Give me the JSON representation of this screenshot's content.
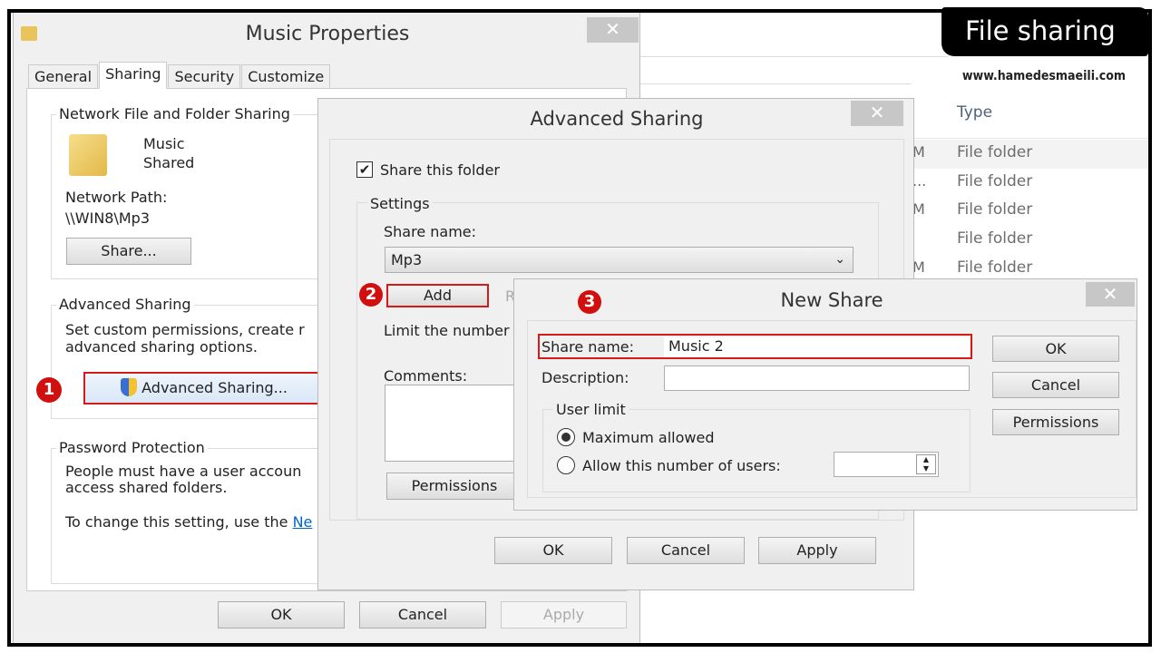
{
  "badge": {
    "title": "File sharing",
    "url": "www.hamedesmaeili.com"
  },
  "explorer": {
    "column_type": "Type",
    "rows": [
      {
        "frag": "M",
        "type": "File folder"
      },
      {
        "frag": "...",
        "type": "File folder"
      },
      {
        "frag": "M",
        "type": "File folder"
      },
      {
        "frag": "",
        "type": "File folder"
      },
      {
        "frag": "M",
        "type": "File folder"
      }
    ]
  },
  "props": {
    "title": "Music Properties",
    "close": "✕",
    "tabs": [
      "General",
      "Sharing",
      "Security",
      "Customize"
    ],
    "active_tab": "Sharing",
    "nffs": {
      "title": "Network File and Folder Sharing",
      "name": "Music",
      "status": "Shared",
      "path_label": "Network Path:",
      "path": "\\\\WIN8\\Mp3",
      "share_btn": "Share..."
    },
    "adv": {
      "title": "Advanced Sharing",
      "text1": "Set custom permissions, create r",
      "text2": "advanced sharing options.",
      "btn": "Advanced Sharing..."
    },
    "pwd": {
      "title": "Password Protection",
      "text1": "People must have a user accoun",
      "text2": "access shared folders.",
      "text3": "To change this setting, use the ",
      "link": "Ne"
    },
    "ok": "OK",
    "cancel": "Cancel",
    "apply": "Apply"
  },
  "adv": {
    "title": "Advanced Sharing",
    "close": "✕",
    "share_folder": "Share this folder",
    "share_checked": true,
    "settings": "Settings",
    "share_name_label": "Share name:",
    "share_name": "Mp3",
    "add": "Add",
    "remove_frag": "R",
    "limit": "Limit the number",
    "comments": "Comments:",
    "permissions": "Permissions",
    "ok": "OK",
    "cancel": "Cancel",
    "apply": "Apply"
  },
  "newshare": {
    "title": "New Share",
    "close": "✕",
    "share_name_label": "Share name:",
    "share_name": "Music 2",
    "description_label": "Description:",
    "description": "",
    "user_limit": "User limit",
    "max_allowed": "Maximum allowed",
    "allow_number": "Allow this number of users:",
    "selected": "max",
    "ok": "OK",
    "cancel": "Cancel",
    "permissions": "Permissions"
  },
  "steps": [
    "1",
    "2",
    "3"
  ],
  "colors": {
    "highlight": "#d61a1a",
    "marker": "#d10f0f",
    "link": "#0066cc"
  }
}
